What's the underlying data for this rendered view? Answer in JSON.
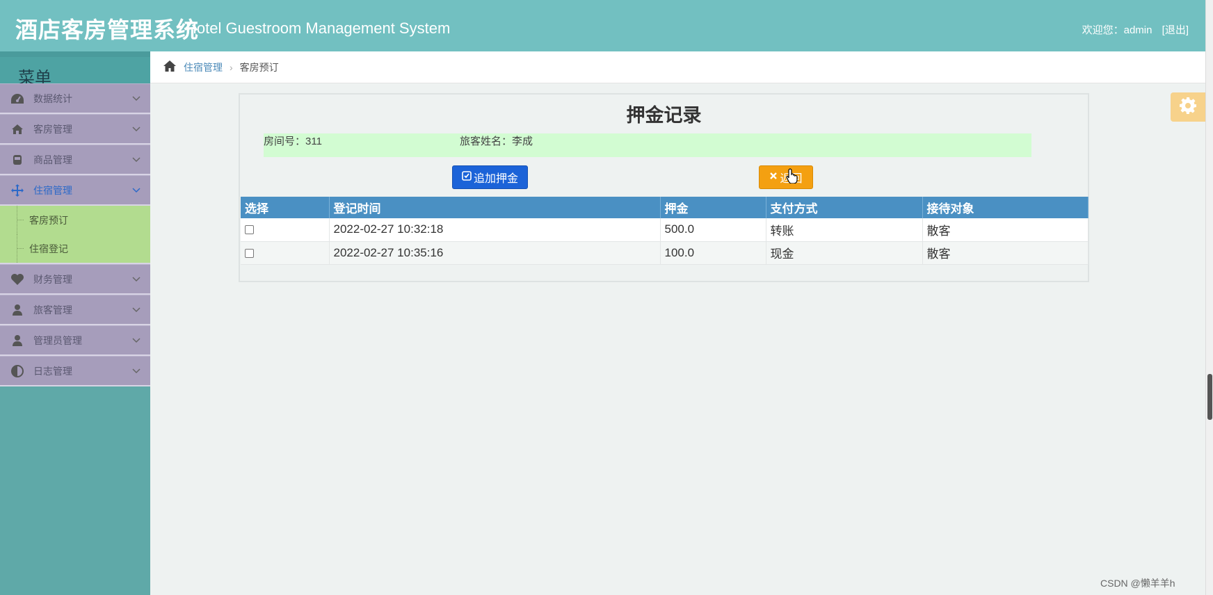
{
  "header": {
    "title": "酒店客房管理系统",
    "subtitle": "Hotel Guestroom Management System",
    "welcome": "欢迎您：admin",
    "logout": "[退出]"
  },
  "sidebar": {
    "menu_title": "菜单",
    "items": [
      {
        "label": "数据统计",
        "icon": "dashboard-icon"
      },
      {
        "label": "客房管理",
        "icon": "home-icon"
      },
      {
        "label": "商品管理",
        "icon": "product-icon"
      },
      {
        "label": "住宿管理",
        "icon": "move-icon",
        "active": true
      },
      {
        "label": "财务管理",
        "icon": "heart-icon"
      },
      {
        "label": "旅客管理",
        "icon": "user-icon"
      },
      {
        "label": "管理员管理",
        "icon": "user-icon"
      },
      {
        "label": "日志管理",
        "icon": "adjust-icon"
      }
    ],
    "subitems": [
      {
        "label": "客房预订"
      },
      {
        "label": "住宿登记"
      }
    ]
  },
  "breadcrumb": {
    "parent": "住宿管理",
    "current": "客房预订"
  },
  "panel": {
    "title": "押金记录",
    "room_label": "房间号：311",
    "guest_label": "旅客姓名：李成",
    "add_button": "追加押金",
    "back_button": "返回"
  },
  "table": {
    "headers": [
      "选择",
      "登记时间",
      "押金",
      "支付方式",
      "接待对象"
    ],
    "rows": [
      {
        "time": "2022-02-27 10:32:18",
        "deposit": "500.0",
        "method": "转账",
        "target": "散客"
      },
      {
        "time": "2022-02-27 10:35:16",
        "deposit": "100.0",
        "method": "现金",
        "target": "散客"
      }
    ]
  },
  "watermark": "CSDN @懒羊羊h",
  "colors": {
    "header": "#72c0c1",
    "sidebar": "#5fa9a8",
    "menu_group": "#a69dbb",
    "submenu": "#b2dc8f",
    "table_header": "#4a90c3",
    "add_button": "#1b63d8",
    "back_button": "#f4a011"
  }
}
